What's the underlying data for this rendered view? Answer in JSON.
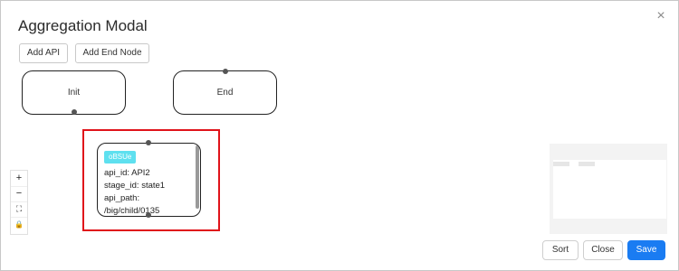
{
  "modal": {
    "title": "Aggregation Modal",
    "close_symbol": "×"
  },
  "toolbar": {
    "add_api_label": "Add API",
    "add_end_node_label": "Add End Node"
  },
  "nodes": {
    "init_label": "Init",
    "end_label": "End"
  },
  "api_node": {
    "tag": "oBSUe",
    "lines": [
      "api_id: API2",
      "stage_id: state1",
      "api_path:",
      "/big/child/0135"
    ]
  },
  "zoom_controls": {
    "zoom_in": "+",
    "zoom_out": "−",
    "fit_view": "⛶",
    "lock": "🔒"
  },
  "footer": {
    "sort_label": "Sort",
    "close_label": "Close",
    "save_label": "Save"
  },
  "colors": {
    "highlight": "#e0131a",
    "tag": "#5ee0ef",
    "primary": "#1a7cf2"
  }
}
